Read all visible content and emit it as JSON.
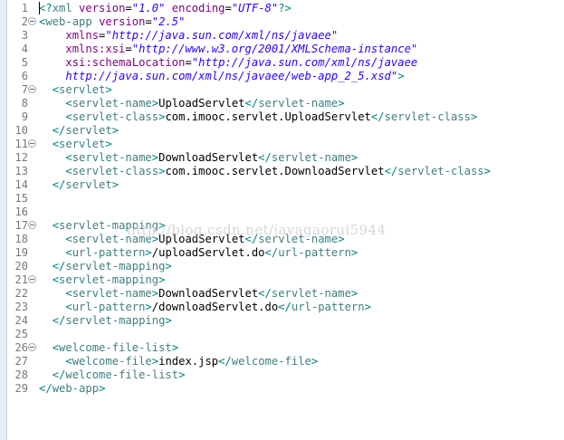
{
  "editor": {
    "watermark": "http://blog.csdn.net/javagaorui5944",
    "lines": [
      {
        "num": "1",
        "fold": false,
        "indent": "",
        "parts": [
          {
            "t": "b",
            "s": "<?"
          },
          {
            "t": "t",
            "s": "xml"
          },
          {
            "t": "tx",
            "s": " "
          },
          {
            "t": "a",
            "s": "version"
          },
          {
            "t": "tx",
            "s": "="
          },
          {
            "t": "v",
            "s": "\"1.0\""
          },
          {
            "t": "tx",
            "s": " "
          },
          {
            "t": "a",
            "s": "encoding"
          },
          {
            "t": "tx",
            "s": "="
          },
          {
            "t": "v",
            "s": "\"UTF-8\""
          },
          {
            "t": "b",
            "s": "?>"
          }
        ]
      },
      {
        "num": "2",
        "fold": true,
        "indent": "",
        "parts": [
          {
            "t": "b",
            "s": "<"
          },
          {
            "t": "t",
            "s": "web-app"
          },
          {
            "t": "tx",
            "s": " "
          },
          {
            "t": "a",
            "s": "version"
          },
          {
            "t": "tx",
            "s": "="
          },
          {
            "t": "v",
            "s": "\"2.5\""
          }
        ]
      },
      {
        "num": "3",
        "fold": false,
        "indent": "    ",
        "parts": [
          {
            "t": "a",
            "s": "xmlns"
          },
          {
            "t": "tx",
            "s": "="
          },
          {
            "t": "v",
            "s": "\"http://java.sun.com/xml/ns/javaee\""
          }
        ]
      },
      {
        "num": "4",
        "fold": false,
        "indent": "    ",
        "parts": [
          {
            "t": "a",
            "s": "xmlns:xsi"
          },
          {
            "t": "tx",
            "s": "="
          },
          {
            "t": "v",
            "s": "\"http://www.w3.org/2001/XMLSchema-instance\""
          }
        ]
      },
      {
        "num": "5",
        "fold": false,
        "indent": "    ",
        "parts": [
          {
            "t": "a",
            "s": "xsi:schemaLocation"
          },
          {
            "t": "tx",
            "s": "="
          },
          {
            "t": "v",
            "s": "\"http://java.sun.com/xml/ns/javaee"
          }
        ]
      },
      {
        "num": "6",
        "fold": false,
        "indent": "    ",
        "parts": [
          {
            "t": "v",
            "s": "http://java.sun.com/xml/ns/javaee/web-app_2_5.xsd\""
          },
          {
            "t": "b",
            "s": ">"
          }
        ]
      },
      {
        "num": "7",
        "fold": true,
        "indent": "  ",
        "parts": [
          {
            "t": "b",
            "s": "<"
          },
          {
            "t": "t",
            "s": "servlet"
          },
          {
            "t": "b",
            "s": ">"
          }
        ]
      },
      {
        "num": "8",
        "fold": false,
        "indent": "    ",
        "parts": [
          {
            "t": "b",
            "s": "<"
          },
          {
            "t": "t",
            "s": "servlet-name"
          },
          {
            "t": "b",
            "s": ">"
          },
          {
            "t": "tx",
            "s": "UploadServlet"
          },
          {
            "t": "b",
            "s": "</"
          },
          {
            "t": "t",
            "s": "servlet-name"
          },
          {
            "t": "b",
            "s": ">"
          }
        ]
      },
      {
        "num": "9",
        "fold": false,
        "indent": "    ",
        "parts": [
          {
            "t": "b",
            "s": "<"
          },
          {
            "t": "t",
            "s": "servlet-class"
          },
          {
            "t": "b",
            "s": ">"
          },
          {
            "t": "tx",
            "s": "com.imooc.servlet.UploadServlet"
          },
          {
            "t": "b",
            "s": "</"
          },
          {
            "t": "t",
            "s": "servlet-class"
          },
          {
            "t": "b",
            "s": ">"
          }
        ]
      },
      {
        "num": "10",
        "fold": false,
        "indent": "  ",
        "parts": [
          {
            "t": "b",
            "s": "</"
          },
          {
            "t": "t",
            "s": "servlet"
          },
          {
            "t": "b",
            "s": ">"
          }
        ]
      },
      {
        "num": "11",
        "fold": true,
        "indent": "  ",
        "parts": [
          {
            "t": "b",
            "s": "<"
          },
          {
            "t": "t",
            "s": "servlet"
          },
          {
            "t": "b",
            "s": ">"
          }
        ]
      },
      {
        "num": "12",
        "fold": false,
        "indent": "    ",
        "parts": [
          {
            "t": "b",
            "s": "<"
          },
          {
            "t": "t",
            "s": "servlet-name"
          },
          {
            "t": "b",
            "s": ">"
          },
          {
            "t": "tx",
            "s": "DownloadServlet"
          },
          {
            "t": "b",
            "s": "</"
          },
          {
            "t": "t",
            "s": "servlet-name"
          },
          {
            "t": "b",
            "s": ">"
          }
        ]
      },
      {
        "num": "13",
        "fold": false,
        "indent": "    ",
        "parts": [
          {
            "t": "b",
            "s": "<"
          },
          {
            "t": "t",
            "s": "servlet-class"
          },
          {
            "t": "b",
            "s": ">"
          },
          {
            "t": "tx",
            "s": "com.imooc.servlet.DownloadServlet"
          },
          {
            "t": "b",
            "s": "</"
          },
          {
            "t": "t",
            "s": "servlet-class"
          },
          {
            "t": "b",
            "s": ">"
          }
        ]
      },
      {
        "num": "14",
        "fold": false,
        "indent": "  ",
        "parts": [
          {
            "t": "b",
            "s": "</"
          },
          {
            "t": "t",
            "s": "servlet"
          },
          {
            "t": "b",
            "s": ">"
          }
        ]
      },
      {
        "num": "15",
        "fold": false,
        "indent": "",
        "parts": []
      },
      {
        "num": "16",
        "fold": false,
        "indent": "",
        "parts": []
      },
      {
        "num": "17",
        "fold": true,
        "indent": "  ",
        "parts": [
          {
            "t": "b",
            "s": "<"
          },
          {
            "t": "t",
            "s": "servlet-mapping"
          },
          {
            "t": "b",
            "s": ">"
          }
        ]
      },
      {
        "num": "18",
        "fold": false,
        "indent": "    ",
        "parts": [
          {
            "t": "b",
            "s": "<"
          },
          {
            "t": "t",
            "s": "servlet-name"
          },
          {
            "t": "b",
            "s": ">"
          },
          {
            "t": "tx",
            "s": "UploadServlet"
          },
          {
            "t": "b",
            "s": "</"
          },
          {
            "t": "t",
            "s": "servlet-name"
          },
          {
            "t": "b",
            "s": ">"
          }
        ]
      },
      {
        "num": "19",
        "fold": false,
        "indent": "    ",
        "parts": [
          {
            "t": "b",
            "s": "<"
          },
          {
            "t": "t",
            "s": "url-pattern"
          },
          {
            "t": "b",
            "s": ">"
          },
          {
            "t": "tx",
            "s": "/uploadServlet.do"
          },
          {
            "t": "b",
            "s": "</"
          },
          {
            "t": "t",
            "s": "url-pattern"
          },
          {
            "t": "b",
            "s": ">"
          }
        ]
      },
      {
        "num": "20",
        "fold": false,
        "indent": "  ",
        "parts": [
          {
            "t": "b",
            "s": "</"
          },
          {
            "t": "t",
            "s": "servlet-mapping"
          },
          {
            "t": "b",
            "s": ">"
          }
        ]
      },
      {
        "num": "21",
        "fold": true,
        "indent": "  ",
        "parts": [
          {
            "t": "b",
            "s": "<"
          },
          {
            "t": "t",
            "s": "servlet-mapping"
          },
          {
            "t": "b",
            "s": ">"
          }
        ]
      },
      {
        "num": "22",
        "fold": false,
        "indent": "    ",
        "parts": [
          {
            "t": "b",
            "s": "<"
          },
          {
            "t": "t",
            "s": "servlet-name"
          },
          {
            "t": "b",
            "s": ">"
          },
          {
            "t": "tx",
            "s": "DownloadServlet"
          },
          {
            "t": "b",
            "s": "</"
          },
          {
            "t": "t",
            "s": "servlet-name"
          },
          {
            "t": "b",
            "s": ">"
          }
        ]
      },
      {
        "num": "23",
        "fold": false,
        "indent": "    ",
        "parts": [
          {
            "t": "b",
            "s": "<"
          },
          {
            "t": "t",
            "s": "url-pattern"
          },
          {
            "t": "b",
            "s": ">"
          },
          {
            "t": "tx",
            "s": "/downloadServlet.do"
          },
          {
            "t": "b",
            "s": "</"
          },
          {
            "t": "t",
            "s": "url-pattern"
          },
          {
            "t": "b",
            "s": ">"
          }
        ]
      },
      {
        "num": "24",
        "fold": false,
        "indent": "  ",
        "parts": [
          {
            "t": "b",
            "s": "</"
          },
          {
            "t": "t",
            "s": "servlet-mapping"
          },
          {
            "t": "b",
            "s": ">"
          }
        ]
      },
      {
        "num": "25",
        "fold": false,
        "indent": "",
        "parts": []
      },
      {
        "num": "26",
        "fold": true,
        "indent": "  ",
        "parts": [
          {
            "t": "b",
            "s": "<"
          },
          {
            "t": "t",
            "s": "welcome-file-list"
          },
          {
            "t": "b",
            "s": ">"
          }
        ]
      },
      {
        "num": "27",
        "fold": false,
        "indent": "    ",
        "parts": [
          {
            "t": "b",
            "s": "<"
          },
          {
            "t": "t",
            "s": "welcome-file"
          },
          {
            "t": "b",
            "s": ">"
          },
          {
            "t": "tx",
            "s": "index.jsp"
          },
          {
            "t": "b",
            "s": "</"
          },
          {
            "t": "t",
            "s": "welcome-file"
          },
          {
            "t": "b",
            "s": ">"
          }
        ]
      },
      {
        "num": "28",
        "fold": false,
        "indent": "  ",
        "parts": [
          {
            "t": "b",
            "s": "</"
          },
          {
            "t": "t",
            "s": "welcome-file-list"
          },
          {
            "t": "b",
            "s": ">"
          }
        ]
      },
      {
        "num": "29",
        "fold": false,
        "indent": "",
        "parts": [
          {
            "t": "b",
            "s": "</"
          },
          {
            "t": "t",
            "s": "web-app"
          },
          {
            "t": "b",
            "s": ">"
          }
        ]
      }
    ]
  }
}
